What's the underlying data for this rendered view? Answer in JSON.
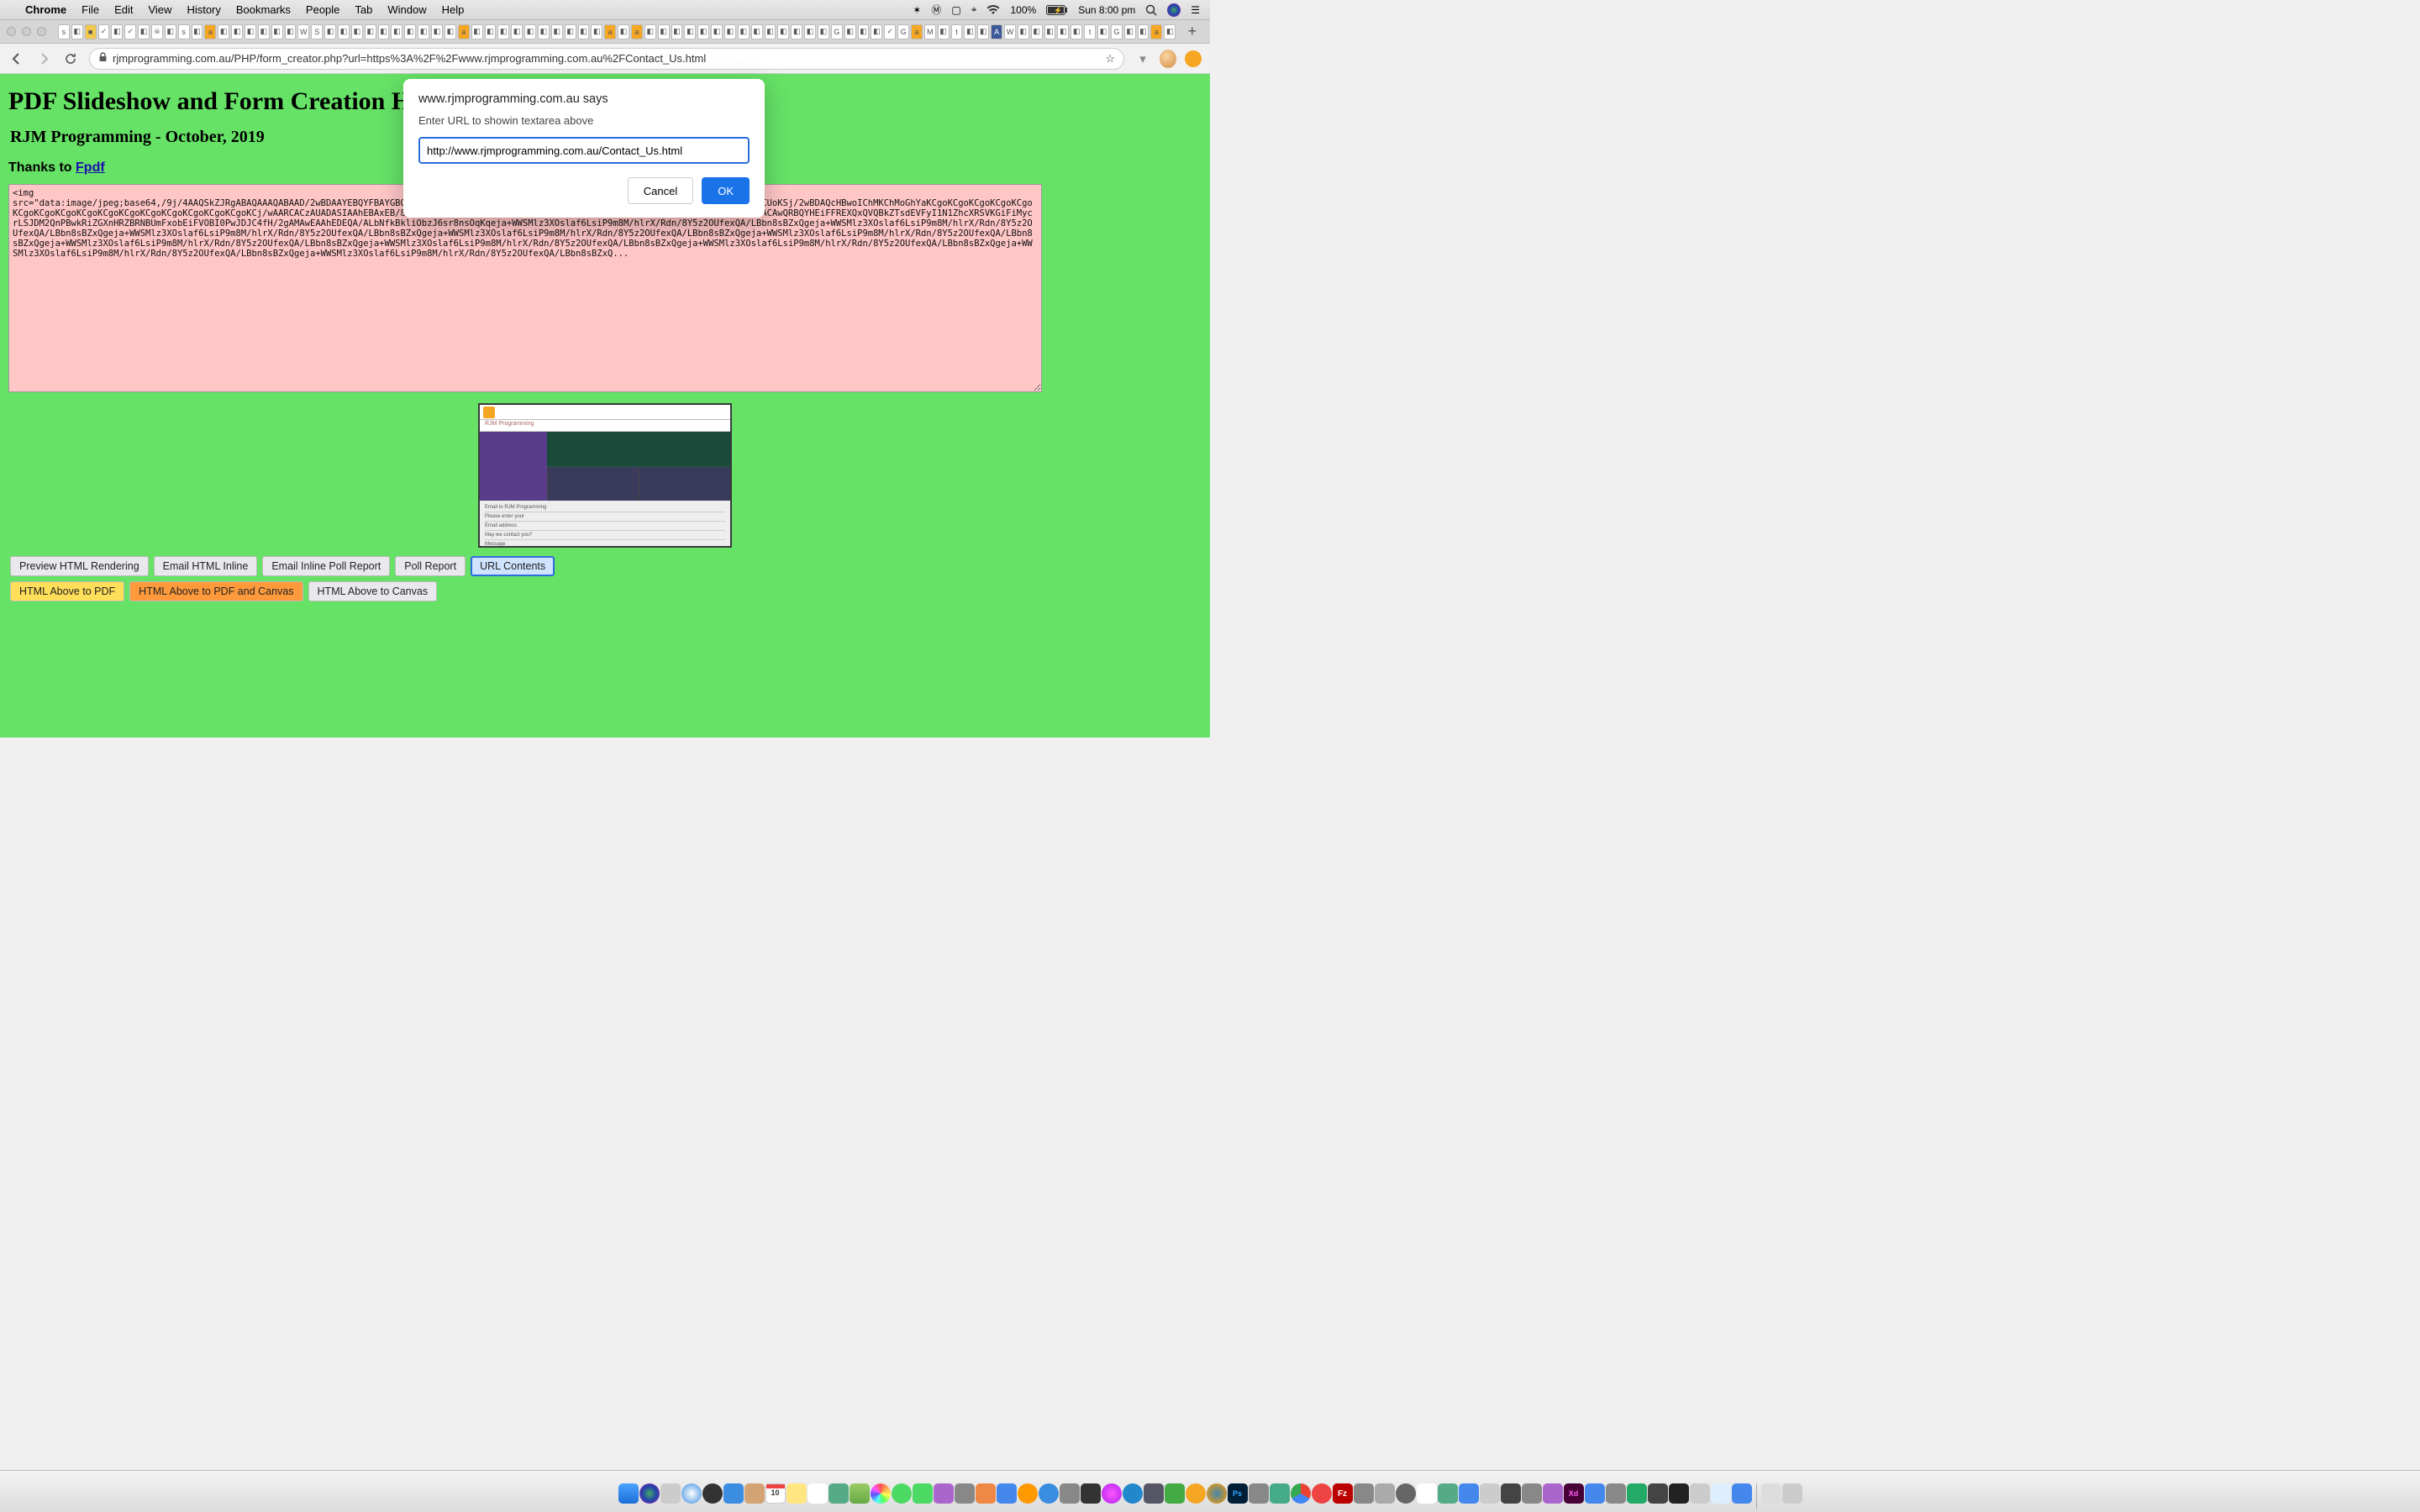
{
  "menubar": {
    "app": "Chrome",
    "items": [
      "File",
      "Edit",
      "View",
      "History",
      "Bookmarks",
      "People",
      "Tab",
      "Window",
      "Help"
    ],
    "battery": "100%",
    "clock": "Sun 8:00 pm"
  },
  "toolbar": {
    "url": "rjmprogramming.com.au/PHP/form_creator.php?url=https%3A%2F%2Fwww.rjmprogramming.com.au%2FContact_Us.html"
  },
  "dialog": {
    "site": "www.rjmprogramming.com.au says",
    "message": "Enter URL to showin textarea above",
    "value": "http://www.rjmprogramming.com.au/Contact_Us.html",
    "cancel": "Cancel",
    "ok": "OK"
  },
  "page": {
    "h1": "PDF Slideshow and Form Creation Helper",
    "h2": "RJM Programming - October, 2019",
    "thanks_prefix": "Thanks to ",
    "thanks_link": "Fpdf",
    "textarea": "<img\nsrc=\"data:image/jpeg;base64,/9j/4AAQSkZJRgABAQAAAQABAAD/2wBDAAYEBQYFBAYGBQYHBwYIChAKCgkJChQODwwQFxQYGBcUFhYaHSUfGhsjHBYWICwgIyYnKSopGR8tMC0oMCUoKSj/2wBDAQcHBwoIChMKChMoGhYaKCgoKCgoKCgoKCgoKCgoKCgoKCgoKCgoKCgoKCgoKCgoKCgoKCgoKCgoKCgoKCgoKCj/wAARCACzAUADASIAAhEBAxEB/8QAHAABAAMBAAMBAAAAAAAAAAAAAQFBgcBAgMI/8QAUxAAAQMCAQULCQQGBwUJAQAAAQACAwQRBQYHEiFFREXQxQVQBkZTsdEVFyI1N1ZhcXRSVKGiFiMycrLSJDM2QnPBwkRiZGXnHRZBRNBUmFxobEiFVOBI0PwJDJC4fH/2gAMAwEAAhEDEQA/ALbNfkBkliObzJ6sr8nsOqKqeja+WWSMlz3XOslaf6LsiP9m8M/hlrX/Rdn/8Y5z2OUfexQA/LBbn8sBZxQgeja+WWSMlz3XOslaf6LsiP9m8M/hlrX/Rdn/8Y5z2OUfexQA/LBbn8sBZxQgeja+WWSMlz3XOslaf6LsiP9m8M/hlrX/Rdn/8Y5z2OUfexQA/LBbn8sBZxQgeja+WWSMlz3XOslaf6LsiP9m8M/hlrX/Rdn/8Y5z2OUfexQA/LBbn8sBZxQgeja+WWSMlz3XOslaf6LsiP9m8M/hlrX/Rdn/8Y5z2OUfexQA/LBbn8sBZxQgeja+WWSMlz3XOslaf6LsiP9m8M/hlrX/Rdn/8Y5z2OUfexQA/LBbn8sBZxQgeja+WWSMlz3XOslaf6LsiP9m8M/hlrX/Rdn/8Y5z2OUfexQA/LBbn8sBZxQgeja+WWSMlz3XOslaf6LsiP9m8M/hlrX/Rdn/8Y5z2OUfexQA/LBbn8sBZxQgeja+WWSMlz3XOslaf6LsiP9m8M/hlrX/Rdn/8Y5z2OUfexQA/LBbn8sBZxQgeja+WWSMlz3XOslaf6LsiP9m8M/hlrX/Rdn/8Y5z2OUfexQA/LBbn8sBZxQ...",
    "buttons_row1": {
      "preview": "Preview HTML Rendering",
      "email_inline": "Email HTML Inline",
      "email_poll": "Email Inline Poll Report",
      "poll_report": "Poll Report",
      "url_contents": "URL Contents"
    },
    "buttons_row2": {
      "html_pdf": "HTML Above to PDF",
      "html_pdf_canvas": "HTML Above to PDF and Canvas",
      "html_canvas": "HTML Above to Canvas"
    },
    "preview_brand": "RJM Programming",
    "preview_rows": [
      "Email to RJM Programming",
      "Please enter your",
      "Email address",
      "May we contact you?",
      "Message"
    ]
  }
}
